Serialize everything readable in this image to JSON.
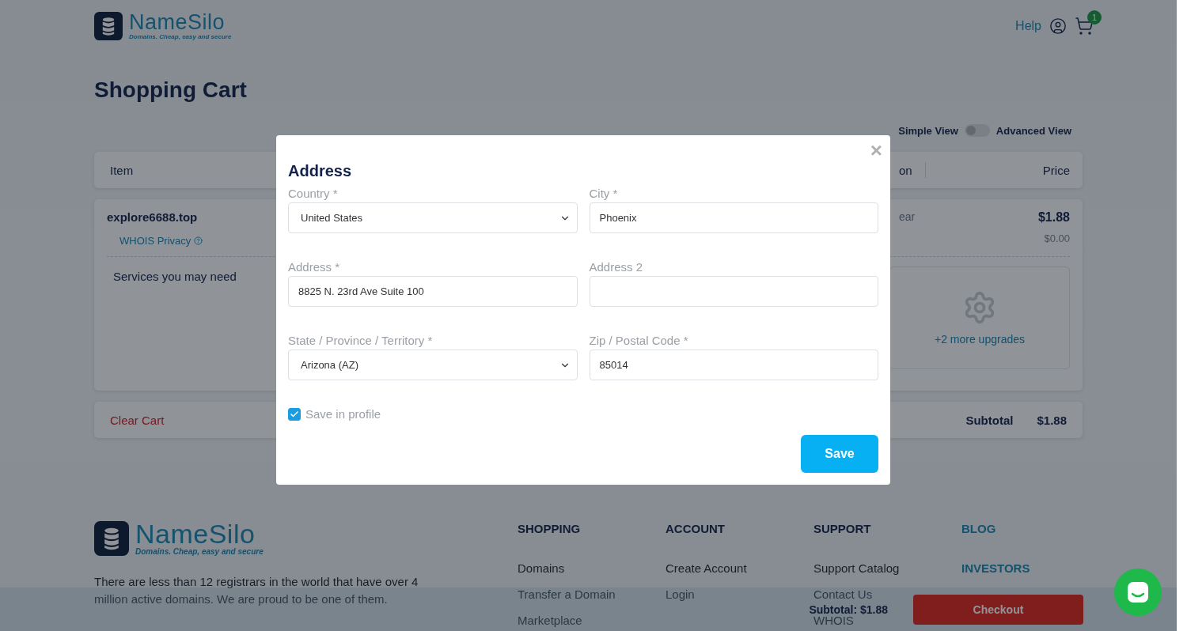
{
  "header": {
    "logo_name": "NameSilo",
    "logo_tagline": "Domains. Cheap, easy and secure",
    "help": "Help",
    "cart_count": "1"
  },
  "page_title": "Shopping Cart",
  "view_toggle": {
    "left": "Simple View",
    "right": "Advanced View",
    "on": false
  },
  "cart": {
    "columns": [
      "Item",
      "on",
      "Price"
    ],
    "item": {
      "domain": "explore6688.top",
      "addon": "WHOIS Privacy",
      "duration": "ear",
      "price": "$1.88",
      "addon_price": "$0.00"
    },
    "services_title": "Services you may need",
    "more_upgrades": "+2 more upgrades",
    "clear": "Clear Cart",
    "subtotal_label": "Subtotal",
    "subtotal": "$1.88"
  },
  "footer": {
    "logo_name": "NameSilo",
    "logo_tagline": "Domains. Cheap, easy and secure",
    "text": "There are less than 12 registrars in the world that have over 4 million active domains. We are proud to be one of them.",
    "columns": [
      {
        "kind": "menu",
        "heading": "SHOPPING",
        "links": [
          "Domains",
          "Transfer a Domain",
          "Marketplace"
        ]
      },
      {
        "kind": "menu",
        "heading": "ACCOUNT",
        "links": [
          "Create Account",
          "Login"
        ]
      },
      {
        "kind": "menu",
        "heading": "SUPPORT",
        "links": [
          "Support Catalog",
          "Contact Us",
          "WHOIS"
        ]
      },
      {
        "kind": "headlines",
        "links": [
          "BLOG",
          "INVESTORS"
        ]
      }
    ]
  },
  "sticky_bar": {
    "subtotal": "Subtotal: $1.88",
    "button": "Checkout"
  },
  "modal": {
    "title": "Address",
    "close": "×",
    "fields": [
      {
        "label": "Country *",
        "kind": "select",
        "value": "United States"
      },
      {
        "label": "City *",
        "kind": "input",
        "value": "Phoenix"
      },
      {
        "label": "Address *",
        "kind": "input",
        "value": "8825 N. 23rd Ave Suite 100"
      },
      {
        "label": "Address 2",
        "kind": "input"
      },
      {
        "label": "State / Province / Territory *",
        "kind": "select",
        "value": "Arizona (AZ)"
      },
      {
        "label": "Zip / Postal Code *",
        "kind": "input",
        "value": "85014"
      }
    ],
    "save_in_profile": {
      "label": "Save in profile",
      "checked": true
    },
    "button": "Save"
  }
}
